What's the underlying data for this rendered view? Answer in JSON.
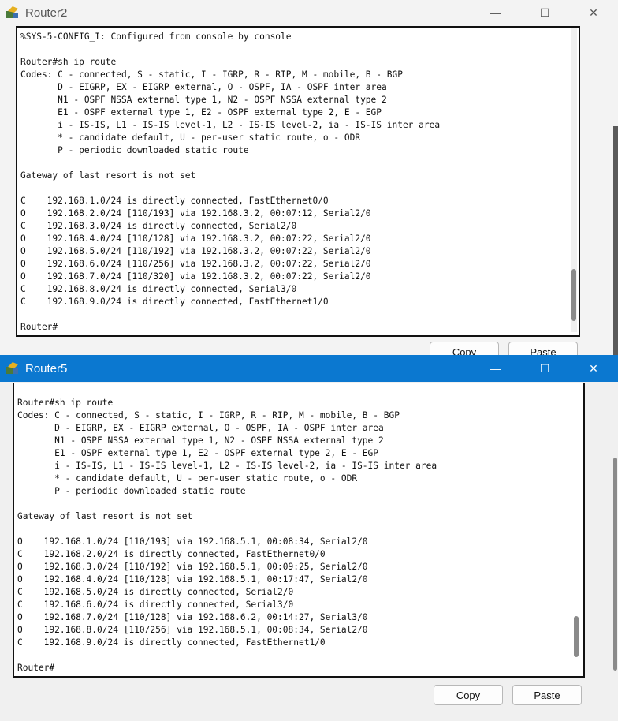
{
  "router2": {
    "title": "Router2",
    "console": "%SYS-5-CONFIG_I: Configured from console by console\n\nRouter#sh ip route\nCodes: C - connected, S - static, I - IGRP, R - RIP, M - mobile, B - BGP\n       D - EIGRP, EX - EIGRP external, O - OSPF, IA - OSPF inter area\n       N1 - OSPF NSSA external type 1, N2 - OSPF NSSA external type 2\n       E1 - OSPF external type 1, E2 - OSPF external type 2, E - EGP\n       i - IS-IS, L1 - IS-IS level-1, L2 - IS-IS level-2, ia - IS-IS inter area\n       * - candidate default, U - per-user static route, o - ODR\n       P - periodic downloaded static route\n\nGateway of last resort is not set\n\nC    192.168.1.0/24 is directly connected, FastEthernet0/0\nO    192.168.2.0/24 [110/193] via 192.168.3.2, 00:07:12, Serial2/0\nC    192.168.3.0/24 is directly connected, Serial2/0\nO    192.168.4.0/24 [110/128] via 192.168.3.2, 00:07:22, Serial2/0\nO    192.168.5.0/24 [110/192] via 192.168.3.2, 00:07:22, Serial2/0\nO    192.168.6.0/24 [110/256] via 192.168.3.2, 00:07:22, Serial2/0\nO    192.168.7.0/24 [110/320] via 192.168.3.2, 00:07:22, Serial2/0\nC    192.168.8.0/24 is directly connected, Serial3/0\nC    192.168.9.0/24 is directly connected, FastEthernet1/0\n\nRouter#",
    "copy_label": "Copy",
    "paste_label": "Paste"
  },
  "router5": {
    "title": "Router5",
    "console": "Router#sh ip route\nCodes: C - connected, S - static, I - IGRP, R - RIP, M - mobile, B - BGP\n       D - EIGRP, EX - EIGRP external, O - OSPF, IA - OSPF inter area\n       N1 - OSPF NSSA external type 1, N2 - OSPF NSSA external type 2\n       E1 - OSPF external type 1, E2 - OSPF external type 2, E - EGP\n       i - IS-IS, L1 - IS-IS level-1, L2 - IS-IS level-2, ia - IS-IS inter area\n       * - candidate default, U - per-user static route, o - ODR\n       P - periodic downloaded static route\n\nGateway of last resort is not set\n\nO    192.168.1.0/24 [110/193] via 192.168.5.1, 00:08:34, Serial2/0\nC    192.168.2.0/24 is directly connected, FastEthernet0/0\nO    192.168.3.0/24 [110/192] via 192.168.5.1, 00:09:25, Serial2/0\nO    192.168.4.0/24 [110/128] via 192.168.5.1, 00:17:47, Serial2/0\nC    192.168.5.0/24 is directly connected, Serial2/0\nC    192.168.6.0/24 is directly connected, Serial3/0\nO    192.168.7.0/24 [110/128] via 192.168.6.2, 00:14:27, Serial3/0\nO    192.168.8.0/24 [110/256] via 192.168.5.1, 00:08:34, Serial2/0\nC    192.168.9.0/24 is directly connected, FastEthernet1/0\n\nRouter#",
    "copy_label": "Copy",
    "paste_label": "Paste"
  },
  "window_controls": {
    "minimize": "—",
    "maximize": "☐",
    "close": "✕"
  },
  "colors": {
    "active_titlebar": "#0b78d0",
    "inactive_titlebar": "#f3f3f3"
  },
  "icons": {
    "app": "packet-tracer-router-icon"
  }
}
